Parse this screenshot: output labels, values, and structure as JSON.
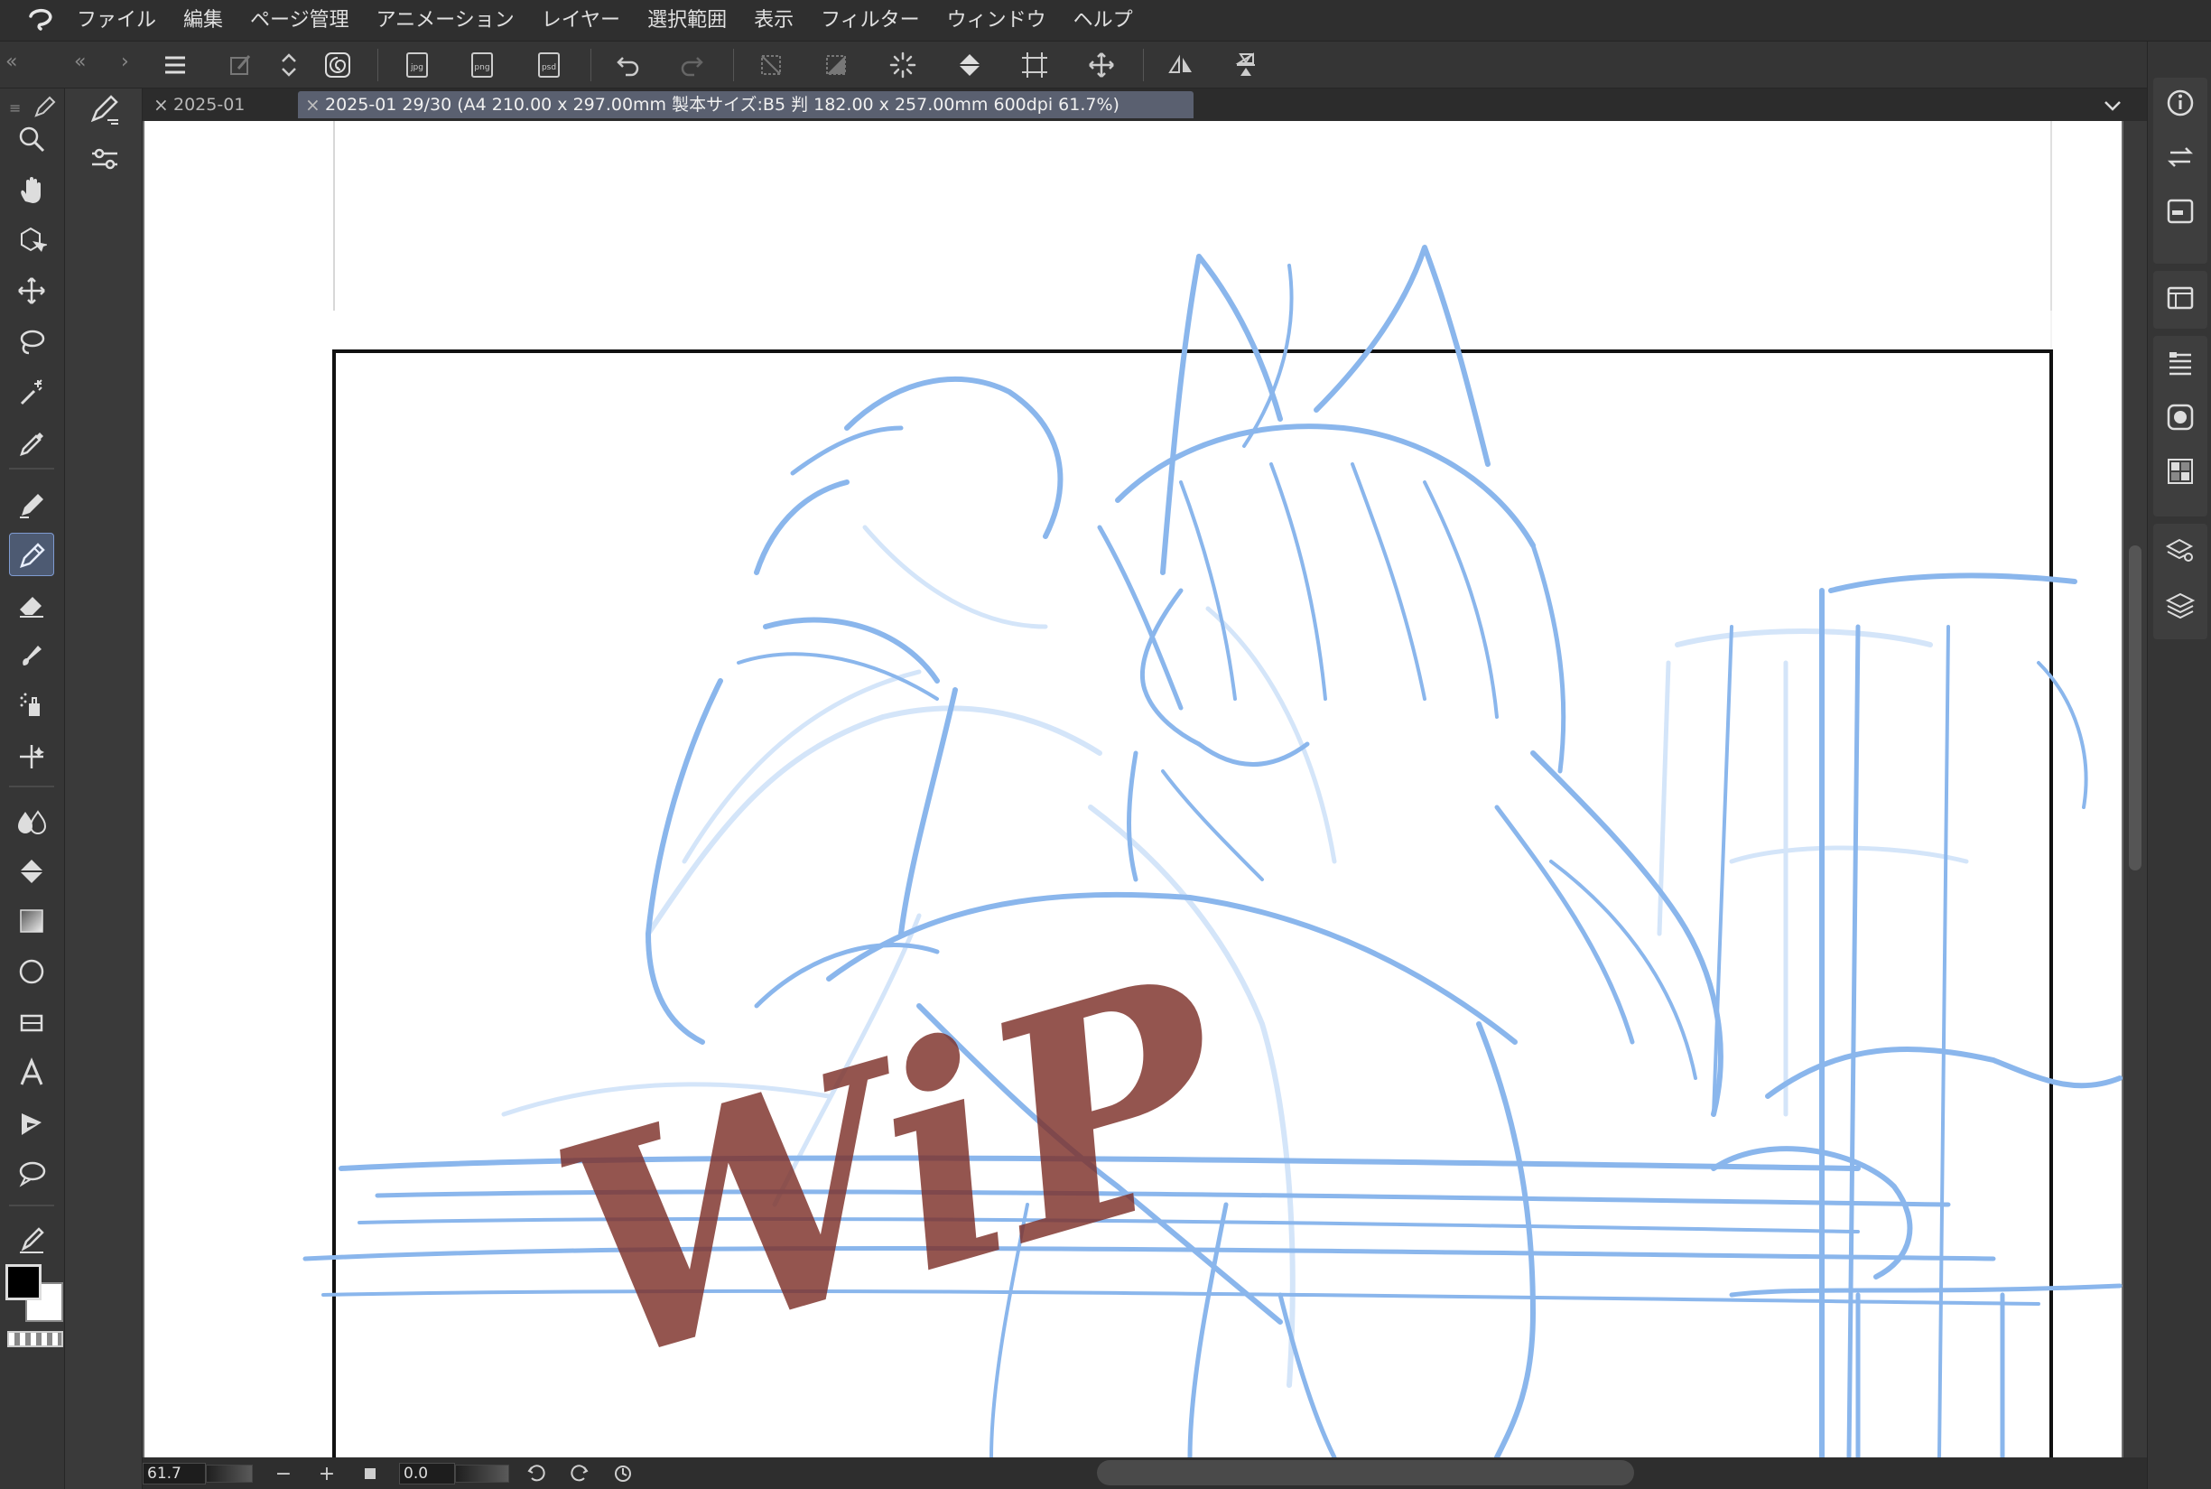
{
  "menu": {
    "items": [
      "ファイル",
      "編集",
      "ページ管理",
      "アニメーション",
      "レイヤー",
      "選択範囲",
      "表示",
      "フィルター",
      "ウィンドウ",
      "ヘルプ"
    ]
  },
  "tabs": [
    {
      "label": "2025-01"
    },
    {
      "label": "2025-01 29/30 (A4 210.00 x 297.00mm 製本サイズ:B5 判 182.00 x 257.00mm 600dpi 61.7%)"
    }
  ],
  "toolbar": {
    "icons": [
      "menu-icon",
      "clear-icon",
      "stepper-icon",
      "spiral-icon",
      "export-jpg-icon",
      "export-png-icon",
      "export-psd-icon",
      "undo-icon",
      "redo-icon",
      "deselect-icon",
      "fill-selection-icon",
      "loading-icon",
      "fill-icon",
      "transform-icon",
      "move-icon",
      "flip-horizontal-icon",
      "flip-vertical-icon"
    ],
    "export_labels": [
      "jpg",
      "png",
      "psd"
    ]
  },
  "tools": [
    "zoom-tool-icon",
    "hand-tool-icon",
    "object-tool-icon",
    "move-tool-icon",
    "lasso-tool-icon",
    "magic-wand-tool-icon",
    "eyedropper-tool-icon",
    "pen-tool-icon",
    "pencil-tool-icon",
    "eraser-tool-icon",
    "brush-tool-icon",
    "airbrush-tool-icon",
    "decoration-tool-icon",
    "blend-tool-icon",
    "fill-tool-icon",
    "gradient-tool-icon",
    "ellipse-tool-icon",
    "frame-tool-icon",
    "text-tool-icon",
    "balloon-tool-icon",
    "speech-bubble-tool-icon",
    "ruler-pen-tool-icon"
  ],
  "active_tool": "pencil-tool-icon",
  "colors": {
    "main": "#000000",
    "sub": "#ffffff",
    "sketch": "#8ab6ec",
    "sketch_light": "#d4e5f9",
    "wip": "#7d2f28",
    "accent": "#7f9bd1"
  },
  "canvas": {
    "watermark": "WiP"
  },
  "status": {
    "zoom": "61.7",
    "rotation": "0.0",
    "minus": "−",
    "plus": "+"
  },
  "right_panel": {
    "icons": [
      "info-icon",
      "navigator-icon",
      "properties-icon",
      "material-icon",
      "layer-property-icon",
      "color-wheel-icon",
      "color-set-icon",
      "layer-search-icon",
      "layers-icon"
    ]
  }
}
